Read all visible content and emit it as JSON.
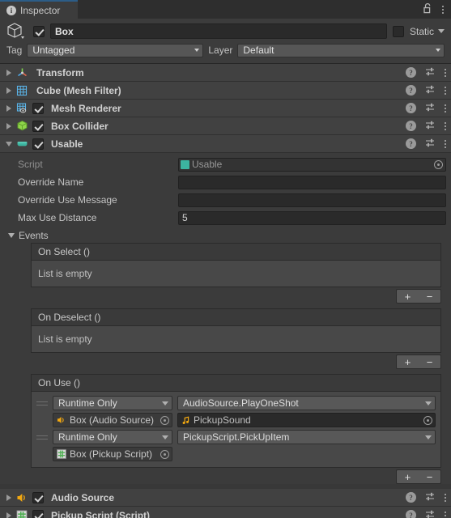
{
  "window": {
    "tab_label": "Inspector",
    "tab_icon": "info-icon",
    "lock_icon": "unlocked-padlock-icon",
    "menu_icon": "kebab-menu-icon",
    "accent_color": "#2c5d87"
  },
  "gameobject": {
    "icon": "cube-icon",
    "active_checked": true,
    "name": "Box",
    "static_label": "Static",
    "static_checked": false,
    "tag_label": "Tag",
    "tag_value": "Untagged",
    "layer_label": "Layer",
    "layer_value": "Default"
  },
  "components": [
    {
      "name": "Transform",
      "icon": "transform-gizmo-icon",
      "expanded": false,
      "has_checkbox": false,
      "enabled": false
    },
    {
      "name": "Cube (Mesh Filter)",
      "icon": "mesh-filter-icon",
      "expanded": false,
      "has_checkbox": false,
      "enabled": false
    },
    {
      "name": "Mesh Renderer",
      "icon": "mesh-renderer-icon",
      "expanded": false,
      "has_checkbox": true,
      "enabled": true
    },
    {
      "name": "Box Collider",
      "icon": "box-collider-icon",
      "expanded": false,
      "has_checkbox": true,
      "enabled": true
    },
    {
      "name": "Usable",
      "icon": "script-capsule-icon",
      "expanded": true,
      "has_checkbox": true,
      "enabled": true
    }
  ],
  "component_tools": {
    "help_icon": "help-icon",
    "preset_icon": "preset-sliders-icon",
    "menu_icon": "kebab-menu-icon"
  },
  "usable": {
    "script_label": "Script",
    "script_value": "Usable",
    "override_name_label": "Override Name",
    "override_name_value": "",
    "override_use_message_label": "Override Use Message",
    "override_use_message_value": "",
    "max_use_distance_label": "Max Use Distance",
    "max_use_distance_value": "5",
    "events_label": "Events",
    "events": [
      {
        "title": "On Select ()",
        "empty_text": "List is empty",
        "entries": []
      },
      {
        "title": "On Deselect ()",
        "empty_text": "List is empty",
        "entries": []
      },
      {
        "title": "On Use ()",
        "empty_text": "",
        "entries": [
          {
            "mode": "Runtime Only",
            "method": "AudioSource.PlayOneShot",
            "target": "Box (Audio Source)",
            "target_icon": "audio-source-icon",
            "argument": "PickupSound",
            "argument_icon": "audio-clip-icon"
          },
          {
            "mode": "Runtime Only",
            "method": "PickupScript.PickUpItem",
            "target": "Box (Pickup Script)",
            "target_icon": "csharp-script-icon",
            "argument": null,
            "argument_icon": null
          }
        ]
      }
    ],
    "add_button_label": "+",
    "remove_button_label": "−"
  },
  "bottom_components": [
    {
      "name": "Audio Source",
      "icon": "audio-source-icon",
      "expanded": false,
      "has_checkbox": true,
      "enabled": true
    },
    {
      "name": "Pickup Script (Script)",
      "icon": "csharp-script-icon",
      "expanded": false,
      "has_checkbox": true,
      "enabled": true
    }
  ]
}
